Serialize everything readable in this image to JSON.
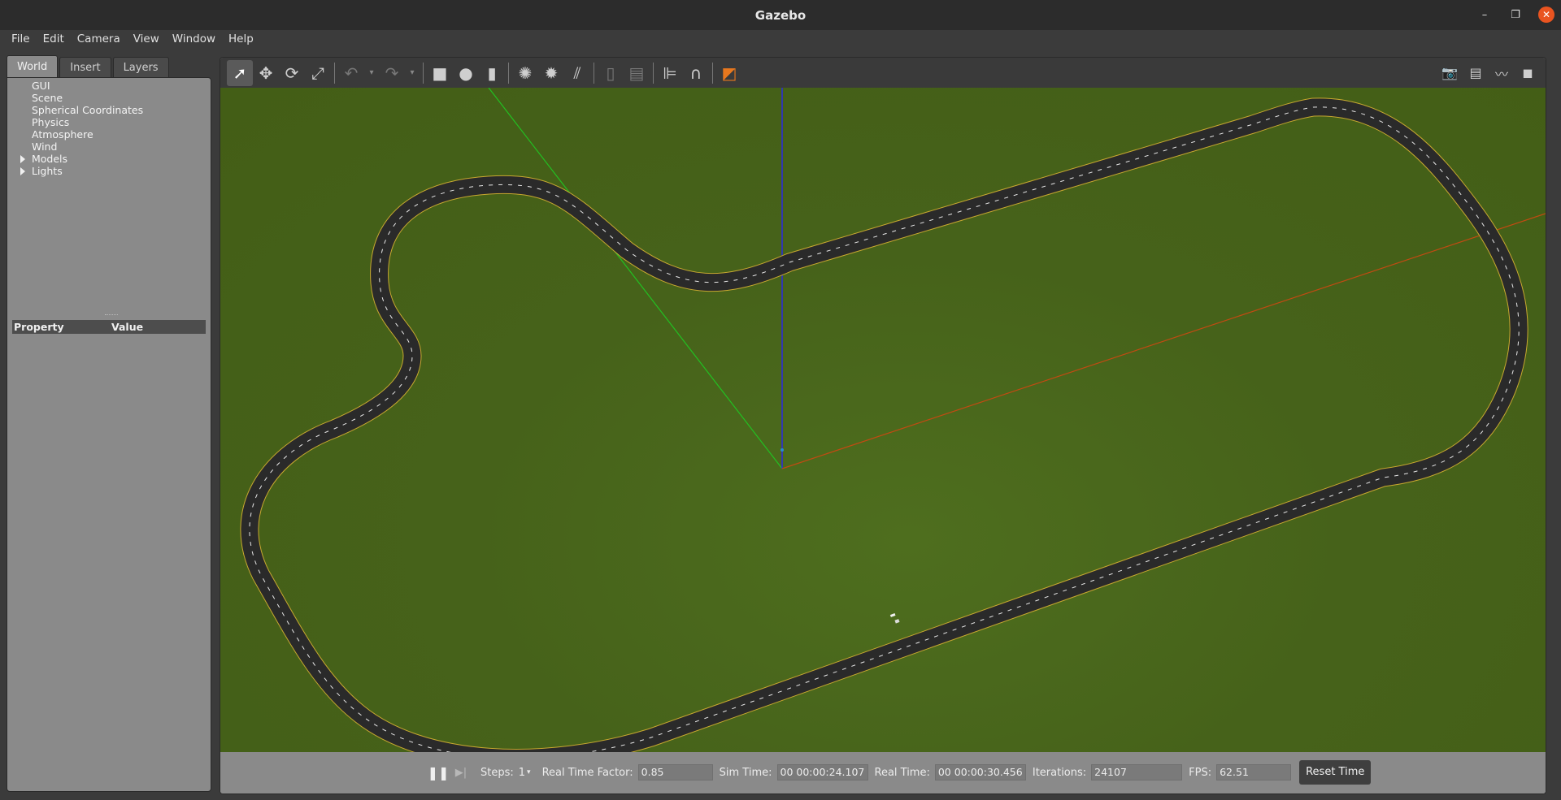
{
  "window": {
    "title": "Gazebo",
    "close_glyph": "✕",
    "minimize_glyph": "–",
    "restore_glyph": "❐"
  },
  "menubar": {
    "items": [
      "File",
      "Edit",
      "Camera",
      "View",
      "Window",
      "Help"
    ]
  },
  "left_panel": {
    "tabs": [
      "World",
      "Insert",
      "Layers"
    ],
    "active_tab": "World",
    "tree": [
      {
        "label": "GUI",
        "expandable": false
      },
      {
        "label": "Scene",
        "expandable": false
      },
      {
        "label": "Spherical Coordinates",
        "expandable": false
      },
      {
        "label": "Physics",
        "expandable": false
      },
      {
        "label": "Atmosphere",
        "expandable": false
      },
      {
        "label": "Wind",
        "expandable": false
      },
      {
        "label": "Models",
        "expandable": true
      },
      {
        "label": "Lights",
        "expandable": true
      }
    ],
    "property_header": {
      "property": "Property",
      "value": "Value"
    }
  },
  "toolbar": {
    "tools": [
      {
        "name": "select-mode-button",
        "icon": "arrow-cursor-icon",
        "glyph": "➚",
        "active": true
      },
      {
        "name": "translate-mode-button",
        "icon": "move-arrows-icon",
        "glyph": "✥"
      },
      {
        "name": "rotate-mode-button",
        "icon": "rotate-icon",
        "glyph": "⟳"
      },
      {
        "name": "scale-mode-button",
        "icon": "scale-icon",
        "glyph": "⤢"
      },
      {
        "sep": true
      },
      {
        "name": "undo-button",
        "icon": "undo-icon",
        "glyph": "↶",
        "disabled": true
      },
      {
        "name": "undo-history-button",
        "icon": "chevron-down-icon",
        "glyph": "▾",
        "small": true
      },
      {
        "name": "redo-button",
        "icon": "redo-icon",
        "glyph": "↷",
        "disabled": true
      },
      {
        "name": "redo-history-button",
        "icon": "chevron-down-icon",
        "glyph": "▾",
        "small": true
      },
      {
        "sep": true
      },
      {
        "name": "box-shape-button",
        "icon": "box-icon",
        "glyph": "■"
      },
      {
        "name": "sphere-shape-button",
        "icon": "sphere-icon",
        "glyph": "●"
      },
      {
        "name": "cylinder-shape-button",
        "icon": "cylinder-icon",
        "glyph": "▮"
      },
      {
        "sep": true
      },
      {
        "name": "point-light-button",
        "icon": "point-light-icon",
        "glyph": "✺"
      },
      {
        "name": "spot-light-button",
        "icon": "spot-light-icon",
        "glyph": "✹"
      },
      {
        "name": "directional-light-button",
        "icon": "directional-light-icon",
        "glyph": "⫽"
      },
      {
        "sep": true
      },
      {
        "name": "copy-button",
        "icon": "copy-icon",
        "glyph": "▯",
        "disabled": true
      },
      {
        "name": "paste-button",
        "icon": "paste-icon",
        "glyph": "▤",
        "disabled": true
      },
      {
        "sep": true
      },
      {
        "name": "align-button",
        "icon": "align-icon",
        "glyph": "⊫"
      },
      {
        "name": "snap-button",
        "icon": "magnet-icon",
        "glyph": "∩"
      },
      {
        "sep": true
      },
      {
        "name": "view-angle-button",
        "icon": "view-angle-cube-icon",
        "glyph": "◩",
        "accent": "#e8781e"
      }
    ],
    "right_tools": [
      {
        "name": "screenshot-button",
        "icon": "camera-icon",
        "glyph": "📷"
      },
      {
        "name": "log-button",
        "icon": "log-icon",
        "glyph": "▤"
      },
      {
        "name": "plot-button",
        "icon": "plot-icon",
        "glyph": "〰"
      },
      {
        "name": "record-video-button",
        "icon": "video-camera-icon",
        "glyph": "◼"
      }
    ]
  },
  "scene": {
    "ground_color": "#46621a",
    "road_color": "#2a2a2a",
    "road_edge_color": "#c8a830",
    "axis_colors": {
      "x": "#c04010",
      "y": "#20c020",
      "z": "#2020e0"
    }
  },
  "statusbar": {
    "pause_glyph": "❚❚",
    "step_glyph": "▶|",
    "steps_label": "Steps:",
    "steps_value": "1",
    "rtf_label": "Real Time Factor:",
    "rtf_value": "0.85",
    "sim_time_label": "Sim Time:",
    "sim_time_value": "00 00:00:24.107",
    "real_time_label": "Real Time:",
    "real_time_value": "00 00:00:30.456",
    "iterations_label": "Iterations:",
    "iterations_value": "24107",
    "fps_label": "FPS:",
    "fps_value": "62.51",
    "reset_label": "Reset Time"
  }
}
